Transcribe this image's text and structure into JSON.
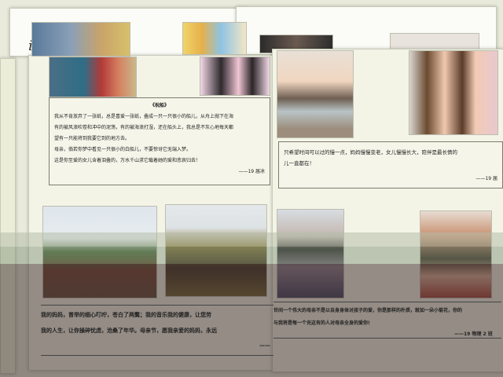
{
  "left_page": {
    "title_fragment_left": "io",
    "title_fragment_right": "u",
    "poem_title": "《祝船》",
    "poem_lines": [
      "我从不肯放弃了一张纸，总是喜爱一张纸，叠成一只一只很小的船儿，从舟上抛下在海",
      "有的被风浪吹卷和冲中的泥荡，有的被海浪打湿，还在船头上，我总是不灰心地每天都",
      "望有一只能将到我要它到的地方去。",
      "母亲，倘若你梦中看见一只很小的白船儿，不要惊讶它无端入梦。",
      "这是你至爱的女儿含着泪叠的，万水千山求它载着她的爱和悲哀归去！"
    ],
    "poem_sign": "——19 届冰",
    "bottom_caption_1": "我的妈妈，曾举的细心叮咛，苍白了两鬓；我的音乐我的健康，让您劳",
    "bottom_caption_2": "我的人生，让你操碎忧虑，沧桑了年华。母亲节，愿我亲爱的妈妈，永远",
    "bottom_sign": "——"
  },
  "right_page": {
    "caption_line_1": "只希望时间可以过的慢一点，妈妈慢慢变老，女儿慢慢长大，陪伴是最长情的",
    "caption_line_2": "儿一直都在！",
    "caption_sign": "——19 届",
    "bottom_caption_1": "世间一个伟大的母亲不是以自身身体对孩子的爱，你是那样的朴质，就如一朵小菊花，你的",
    "bottom_caption_2": "与我将是每一个充这有的人对母亲全身的爱你!",
    "bottom_sign": "——19 物理 2 班"
  }
}
